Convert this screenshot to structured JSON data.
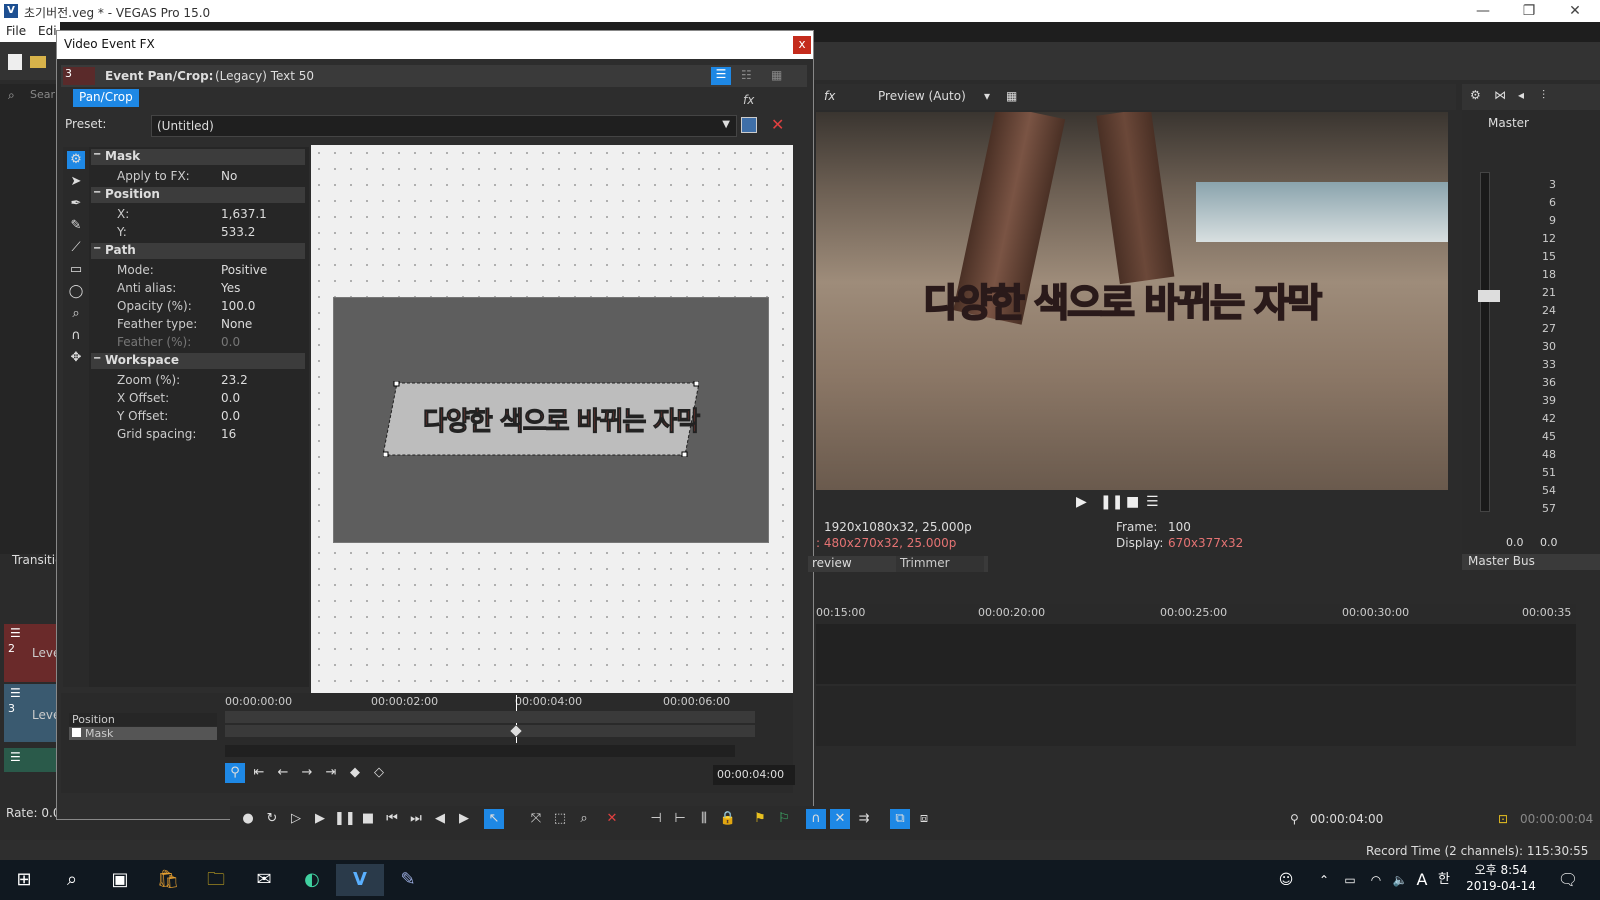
{
  "window": {
    "title": "초기버전.veg * - VEGAS Pro 15.0",
    "logo": "V",
    "minimize": "—",
    "maximize": "❐",
    "close": "✕"
  },
  "menu": {
    "file": "File",
    "edit": "Edi"
  },
  "explorer": {
    "search": "Sear"
  },
  "dialog": {
    "title": "Video Event FX",
    "close": "x",
    "track_number": "3",
    "fx_label": "Event Pan/Crop:",
    "fx_name": "(Legacy) Text 50",
    "tab": "Pan/Crop",
    "preset_label": "Preset:",
    "preset_value": "(Untitled)",
    "sections": {
      "mask": "Mask",
      "position": "Position",
      "path": "Path",
      "workspace": "Workspace"
    },
    "props": {
      "apply_fx_k": "Apply to FX:",
      "apply_fx_v": "No",
      "x_k": "X:",
      "x_v": "1,637.1",
      "y_k": "Y:",
      "y_v": "533.2",
      "mode_k": "Mode:",
      "mode_v": "Positive",
      "anti_k": "Anti alias:",
      "anti_v": "Yes",
      "opac_k": "Opacity (%):",
      "opac_v": "100.0",
      "fth_k": "Feather type:",
      "fth_v": "None",
      "fthp_k": "Feather (%):",
      "fthp_v": "0.0",
      "zoom_k": "Zoom (%):",
      "zoom_v": "23.2",
      "xo_k": "X Offset:",
      "xo_v": "0.0",
      "yo_k": "Y Offset:",
      "yo_v": "0.0",
      "grid_k": "Grid spacing:",
      "grid_v": "16"
    },
    "canvas_text": "다양한 색으로 바뀌는 자막",
    "kf_ruler": [
      "00:00:00:00",
      "00:00:02:00",
      "00:00:04:00",
      "00:00:06:00"
    ],
    "kf_tracks": [
      "Position",
      "Mask"
    ],
    "kf_time": "00:00:04:00"
  },
  "preview": {
    "mode": "Preview (Auto)",
    "overlay_text": "다양한 색으로 바뀌는 자막",
    "info_left1": "1920x1080x32, 25.000p",
    "info_left2": ": 480x270x32, 25.000p",
    "frame_label": "Frame:",
    "frame_value": "100",
    "display_label": "Display:",
    "display_value": "670x377x32",
    "tab_preview": "review",
    "tab_trimmer": "Trimmer"
  },
  "master": {
    "label": "Master",
    "tab": "Master Bus",
    "scale": [
      "3",
      "6",
      "9",
      "12",
      "15",
      "18",
      "21",
      "24",
      "27",
      "30",
      "33",
      "36",
      "39",
      "42",
      "45",
      "48",
      "51",
      "54",
      "57"
    ],
    "left_val": "0.0",
    "right_val": "0.0"
  },
  "timeline": {
    "ruler": [
      "00:15:00",
      "00:00:20:00",
      "00:00:25:00",
      "00:00:30:00",
      "00:00:35"
    ],
    "transitions": "Transitio",
    "track2_num": "2",
    "track2_label": "Leve",
    "track3_num": "3",
    "track3_label": "Leve",
    "rate": "Rate: 0.00",
    "cursor_time": "00:00:04:00",
    "end_time": "00:00:00:04"
  },
  "status": {
    "record": "Record Time (2 channels): 115:30:55"
  },
  "taskbar": {
    "time": "오후 8:54",
    "date": "2019-04-14",
    "ime": "A",
    "ime2": "한"
  }
}
